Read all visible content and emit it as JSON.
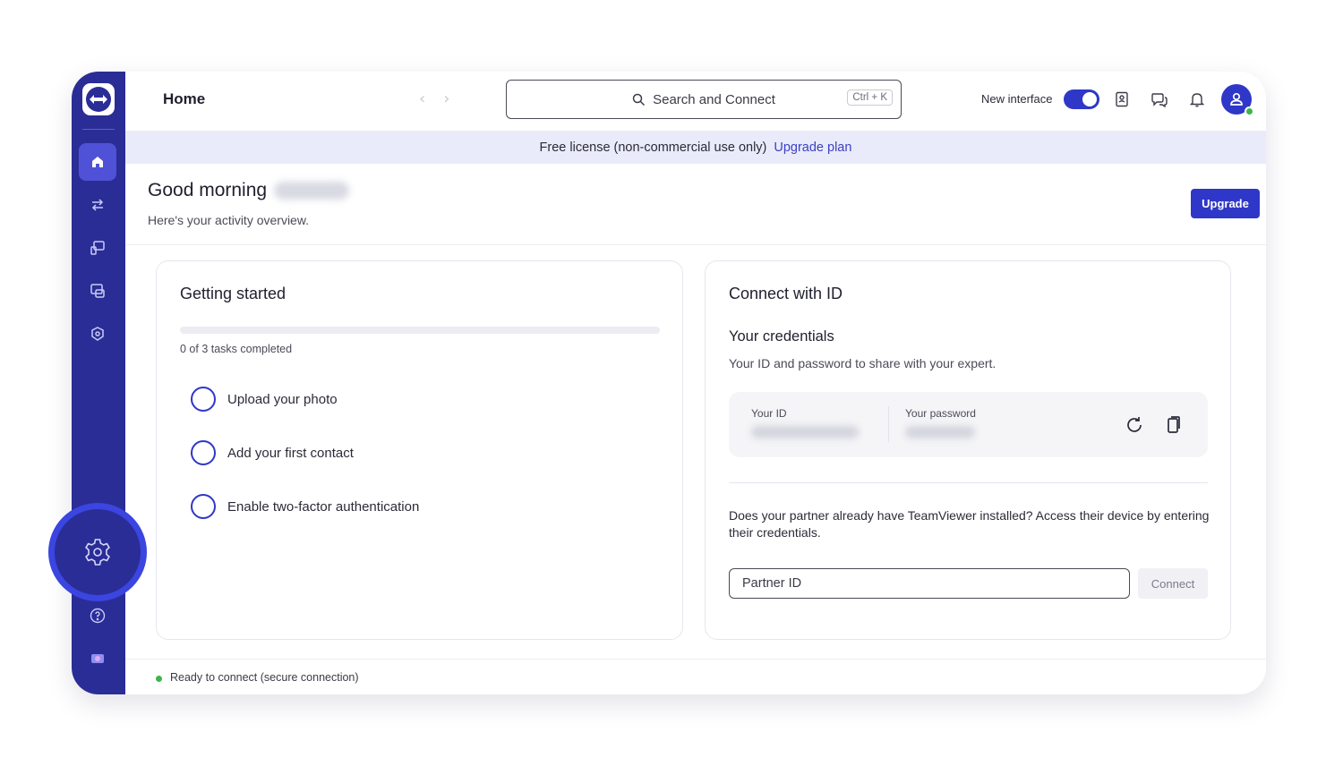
{
  "sidebar": {
    "logo_icon": "teamviewer-logo-icon",
    "items": [
      {
        "name": "home",
        "icon": "home-icon",
        "active": true
      },
      {
        "name": "transfers",
        "icon": "swap-arrows-icon",
        "active": false
      },
      {
        "name": "remote-devices",
        "icon": "monitor-icon",
        "active": false
      },
      {
        "name": "sessions",
        "icon": "screen-share-icon",
        "active": false
      },
      {
        "name": "security",
        "icon": "shield-icon",
        "active": false
      }
    ],
    "bottom": [
      {
        "name": "settings",
        "icon": "gear-icon"
      },
      {
        "name": "help",
        "icon": "question-circle-icon"
      },
      {
        "name": "record",
        "icon": "record-icon"
      }
    ]
  },
  "topbar": {
    "title": "Home",
    "search": {
      "label": "Search and Connect",
      "shortcut": "Ctrl + K"
    },
    "new_interface_label": "New interface",
    "new_interface_enabled": true
  },
  "banner": {
    "text": "Free license (non-commercial use only)",
    "link": "Upgrade plan"
  },
  "header": {
    "greeting": "Good morning",
    "subtitle": "Here's your activity overview.",
    "upgrade_label": "Upgrade"
  },
  "getting_started": {
    "title": "Getting started",
    "progress_fraction": 0,
    "tasks_completed_text": "0 of 3 tasks completed",
    "tasks": [
      {
        "label": "Upload your photo",
        "done": false
      },
      {
        "label": "Add your first contact",
        "done": false
      },
      {
        "label": "Enable two-factor authentication",
        "done": false
      }
    ]
  },
  "connect": {
    "title": "Connect with ID",
    "credentials_title": "Your credentials",
    "credentials_subtitle": "Your ID and password to share with your expert.",
    "id_label": "Your ID",
    "password_label": "Your password",
    "partner_text": "Does your partner already have TeamViewer installed? Access their device by entering their credentials.",
    "partner_placeholder": "Partner ID",
    "connect_label": "Connect"
  },
  "status": {
    "text": "Ready to connect (secure connection)",
    "color": "#3cb54a"
  },
  "colors": {
    "sidebar": "#2a2d96",
    "accent": "#2f37c8",
    "banner_bg": "#e9ebfa",
    "highlight_ring": "#3b45e0"
  }
}
